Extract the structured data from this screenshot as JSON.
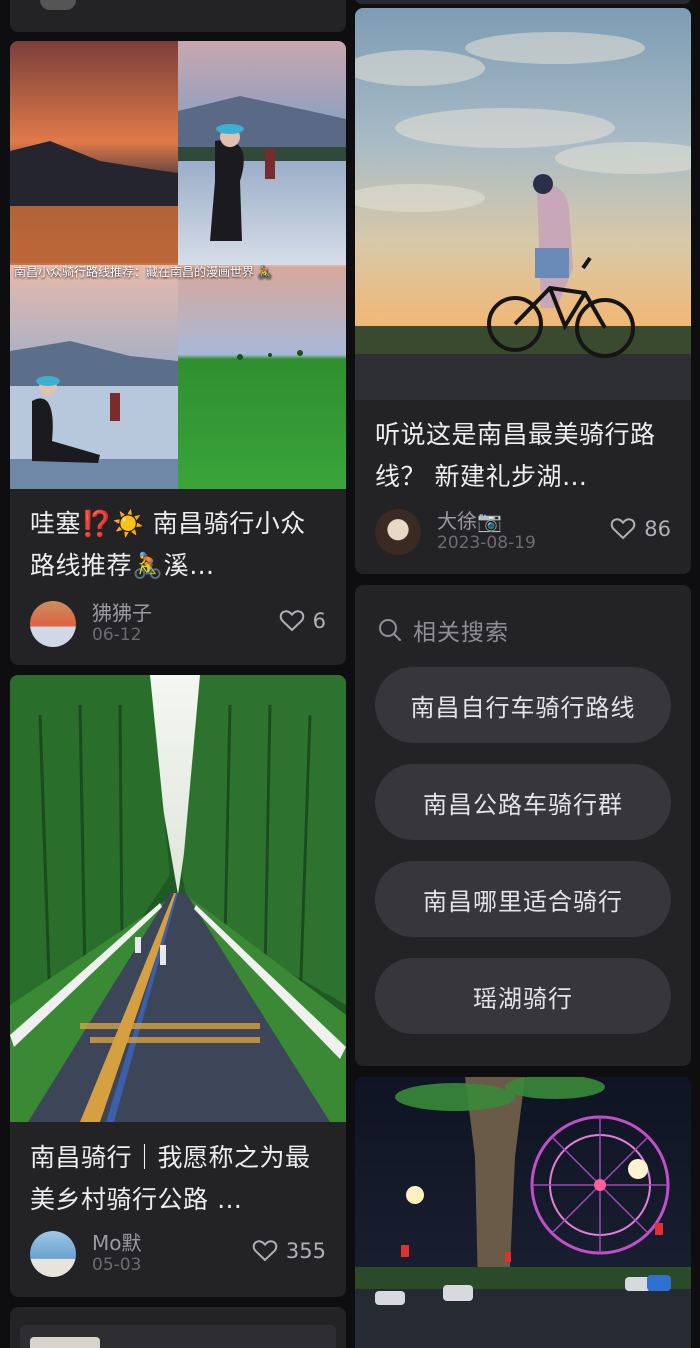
{
  "feed": {
    "cards": [
      {
        "title": "哇塞⁉️☀️ 南昌骑行小众路线推荐🚴溪…",
        "overlay_caption": "南昌小众骑行路线推荐：藏在南昌的漫画世界 🚴",
        "author": "狒狒子",
        "date": "06-12",
        "likes": "6"
      },
      {
        "title": "南昌骑行｜我愿称之为最美乡村骑行公路 …",
        "author": "Mo默",
        "date": "05-03",
        "likes": "355"
      },
      {
        "title": "听说这是南昌最美骑行路线？ 新建礼步湖…",
        "author": "大徐📷",
        "date": "2023-08-19",
        "likes": "86"
      }
    ],
    "related_search": {
      "heading": "相关搜索",
      "items": [
        "南昌自行车骑行路线",
        "南昌公路车骑行群",
        "南昌哪里适合骑行",
        "瑶湖骑行"
      ]
    }
  },
  "icons": {
    "like": "heart-outline-icon",
    "search": "search-icon"
  },
  "colors": {
    "background": "#0e0e10",
    "card": "#232326",
    "pill": "#37373b",
    "text_primary": "#ededf0",
    "text_secondary": "#9a9aa0"
  }
}
